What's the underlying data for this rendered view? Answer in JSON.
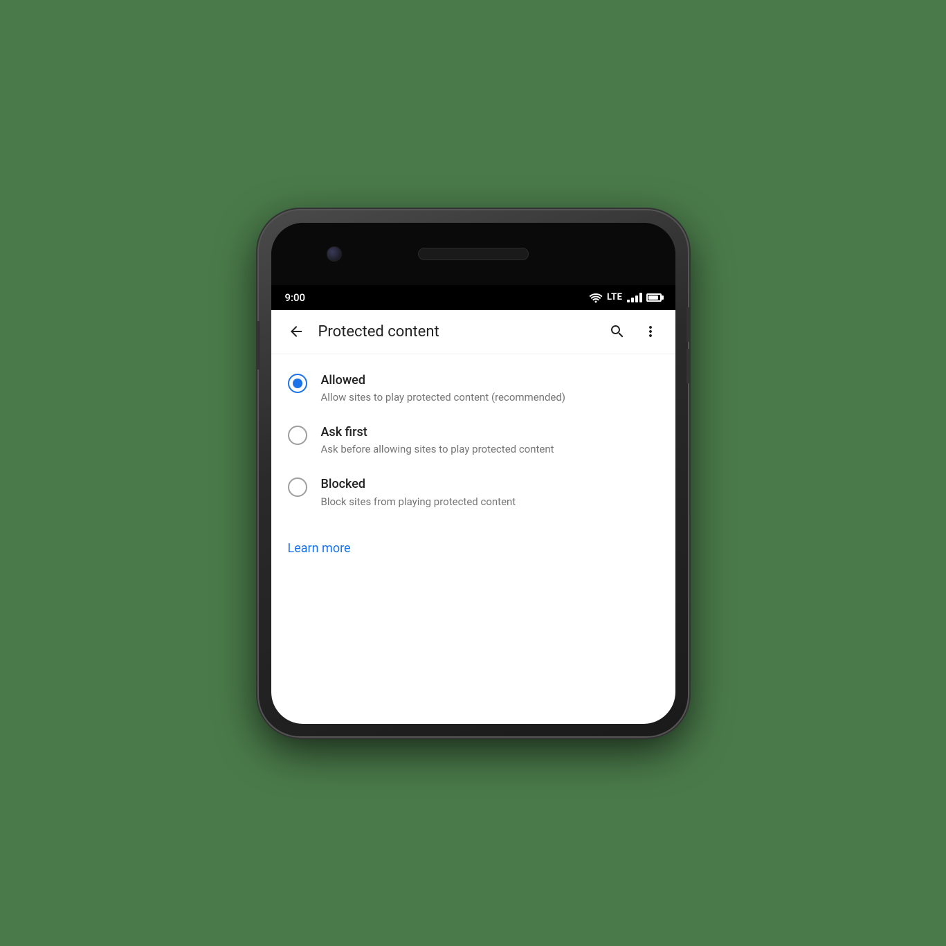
{
  "status_bar": {
    "time": "9:00",
    "lte": "LTE"
  },
  "app_bar": {
    "title": "Protected content",
    "back_label": "back",
    "search_label": "search",
    "more_label": "more options"
  },
  "options": [
    {
      "id": "allowed",
      "title": "Allowed",
      "description": "Allow sites to play protected content (recommended)",
      "selected": true
    },
    {
      "id": "ask-first",
      "title": "Ask first",
      "description": "Ask before allowing sites to play protected content",
      "selected": false
    },
    {
      "id": "blocked",
      "title": "Blocked",
      "description": "Block sites from playing protected content",
      "selected": false
    }
  ],
  "learn_more": {
    "label": "Learn more"
  },
  "colors": {
    "accent": "#1a73e8",
    "text_primary": "#212121",
    "text_secondary": "#757575",
    "radio_unselected": "#9e9e9e"
  }
}
